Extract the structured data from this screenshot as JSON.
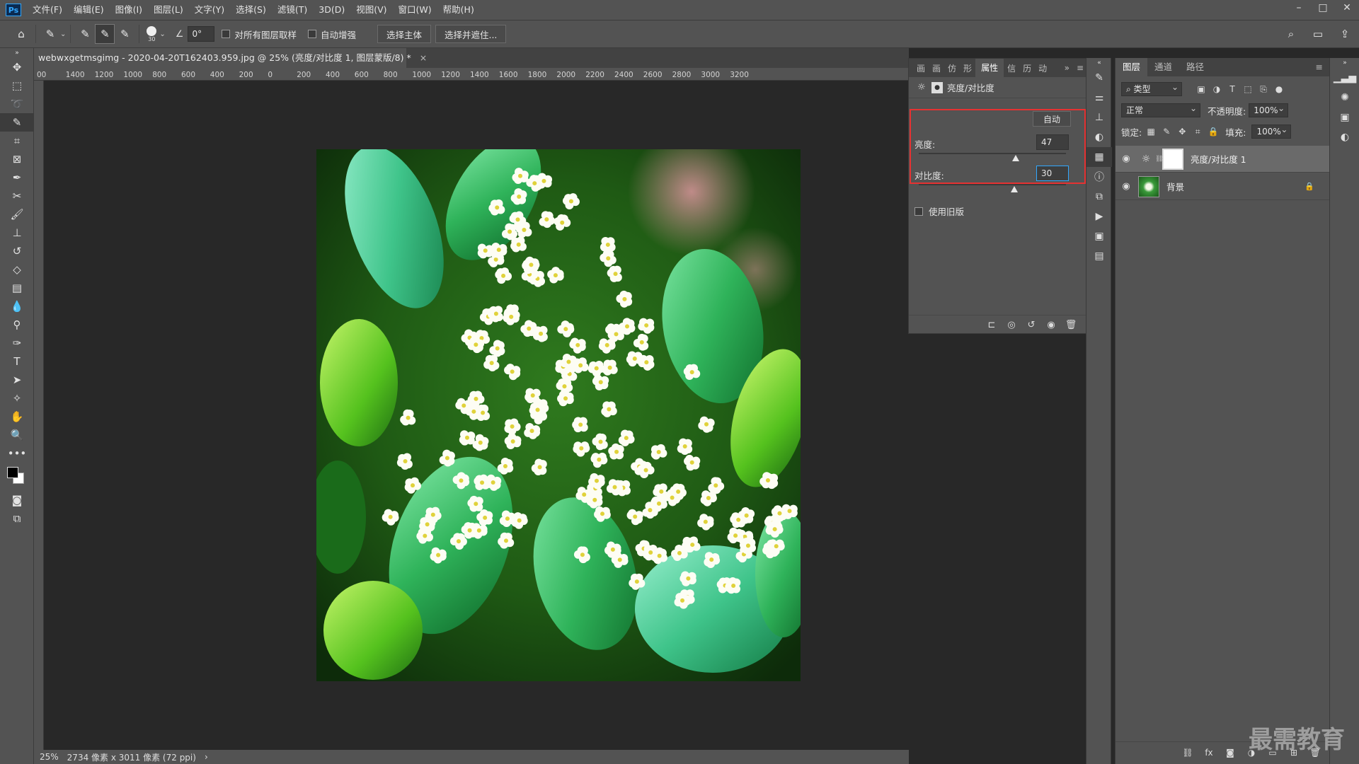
{
  "menu": [
    "文件(F)",
    "编辑(E)",
    "图像(I)",
    "图层(L)",
    "文字(Y)",
    "选择(S)",
    "滤镜(T)",
    "3D(D)",
    "视图(V)",
    "窗口(W)",
    "帮助(H)"
  ],
  "options": {
    "brush_size": "30",
    "angle_value": "0°",
    "sample_all_label": "对所有图层取样",
    "auto_enhance_label": "自动增强",
    "select_subject_label": "选择主体",
    "select_mask_label": "选择并遮住..."
  },
  "document": {
    "tab_title": "webwxgetmsgimg - 2020-04-20T162403.959.jpg @ 25% (亮度/对比度 1, 图层蒙版/8) *",
    "zoom": "25%",
    "info": "2734 像素 x 3011 像素 (72 ppi)"
  },
  "ruler_labels": [
    "00",
    "1400",
    "1200",
    "1000",
    "800",
    "600",
    "400",
    "200",
    "0",
    "200",
    "400",
    "600",
    "800",
    "1000",
    "1200",
    "1400",
    "1600",
    "1800",
    "2000",
    "2200",
    "2400",
    "2600",
    "2800",
    "3000",
    "3200"
  ],
  "properties": {
    "tabs": [
      "画",
      "画",
      "仿",
      "形",
      "属性",
      "信",
      "历",
      "动"
    ],
    "active_tab": "属性",
    "header_title": "亮度/对比度",
    "auto_label": "自动",
    "brightness_label": "亮度:",
    "brightness_value": "47",
    "brightness_fraction": 0.66,
    "contrast_label": "对比度:",
    "contrast_value": "30",
    "contrast_fraction": 0.65,
    "legacy_label": "使用旧版"
  },
  "layers": {
    "tabs": [
      "图层",
      "通道",
      "路径"
    ],
    "active_tab": "图层",
    "filter_label": "类型",
    "blend_mode": "正常",
    "opacity_label": "不透明度:",
    "opacity_value": "100%",
    "lock_label": "锁定:",
    "fill_label": "填充:",
    "fill_value": "100%",
    "items": [
      {
        "name": "亮度/对比度 1",
        "selected": true
      },
      {
        "name": "背景",
        "selected": false
      }
    ]
  },
  "watermark": "最需教育",
  "colors": {
    "accent_red": "#e63232",
    "panel_bg": "#535353",
    "canvas_bg": "#282828"
  }
}
